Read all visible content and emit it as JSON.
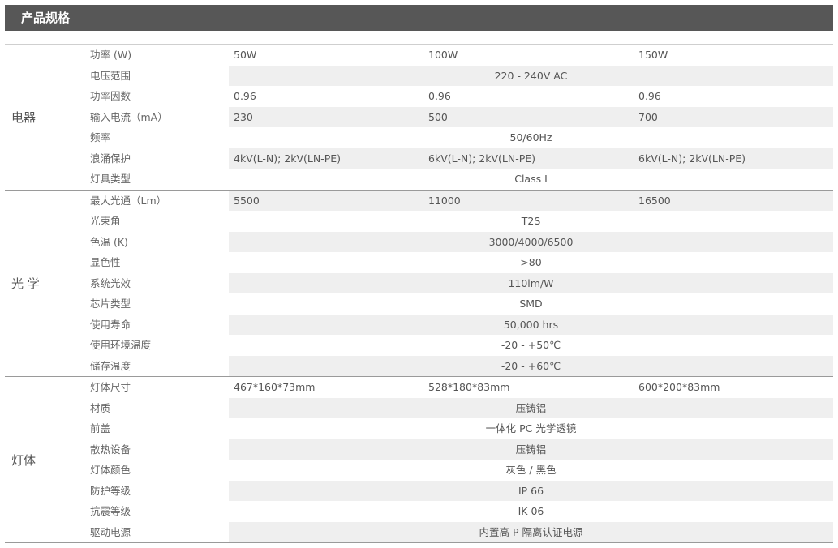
{
  "title": "产品规格",
  "groups": [
    {
      "label": "电器",
      "rows": [
        {
          "name": "功率 (W)",
          "cells": [
            "50W",
            "100W",
            "150W"
          ]
        },
        {
          "name": "电压范围",
          "value": "220 - 240V AC"
        },
        {
          "name": "功率因数",
          "cells": [
            "0.96",
            "0.96",
            "0.96"
          ]
        },
        {
          "name": "输入电流（mA）",
          "cells": [
            "230",
            "500",
            "700"
          ]
        },
        {
          "name": "频率",
          "value": "50/60Hz"
        },
        {
          "name": "浪涌保护",
          "cells": [
            "4kV(L-N); 2kV(LN-PE)",
            "6kV(L-N); 2kV(LN-PE)",
            "6kV(L-N); 2kV(LN-PE)"
          ]
        },
        {
          "name": "灯具类型",
          "value": "Class I"
        }
      ]
    },
    {
      "label": "光 学",
      "rows": [
        {
          "name": "最大光通（Lm）",
          "cells": [
            "5500",
            "11000",
            "16500"
          ]
        },
        {
          "name": "光束角",
          "value": "T2S"
        },
        {
          "name": "色温 (K)",
          "value": "3000/4000/6500"
        },
        {
          "name": "显色性",
          "value": ">80"
        },
        {
          "name": "系统光效",
          "value": "110lm/W"
        },
        {
          "name": "芯片类型",
          "value": "SMD"
        },
        {
          "name": "使用寿命",
          "value": "50,000 hrs"
        },
        {
          "name": "使用环境温度",
          "value": "-20 - +50℃"
        },
        {
          "name": "储存温度",
          "value": "-20 - +60℃"
        }
      ]
    },
    {
      "label": "灯体",
      "rows": [
        {
          "name": "灯体尺寸",
          "cells": [
            "467*160*73mm",
            "528*180*83mm",
            "600*200*83mm"
          ]
        },
        {
          "name": "材质",
          "value": "压铸铝"
        },
        {
          "name": "前盖",
          "value": "一体化 PC 光学透镜"
        },
        {
          "name": "散热设备",
          "value": "压铸铝"
        },
        {
          "name": "灯体颜色",
          "value": "灰色 / 黑色"
        },
        {
          "name": "防护等级",
          "value": "IP 66"
        },
        {
          "name": "抗震等级",
          "value": "IK 06"
        },
        {
          "name": "驱动电源",
          "value": "内置高 P 隔离认证电源"
        }
      ]
    }
  ]
}
